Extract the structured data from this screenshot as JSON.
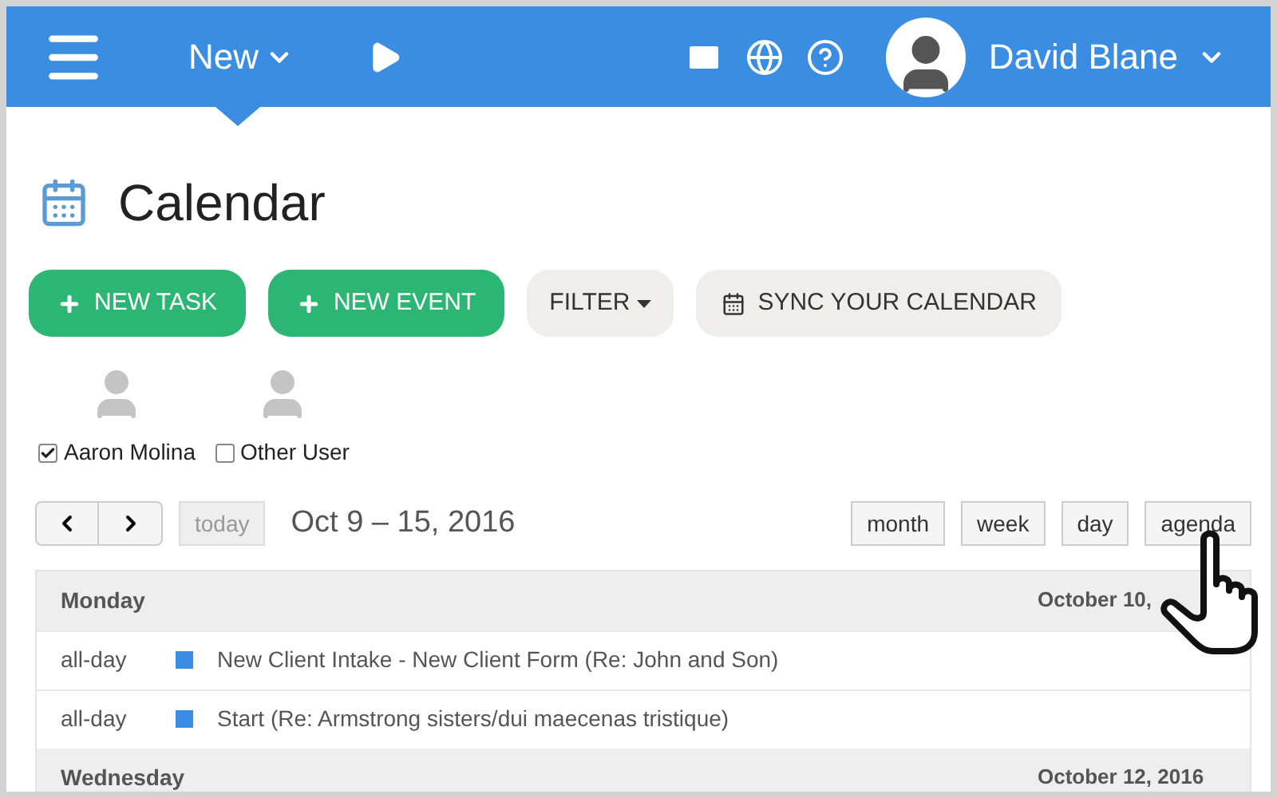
{
  "header": {
    "new_menu": "New",
    "user_name": "David Blane"
  },
  "page_title": "Calendar",
  "actions": [
    {
      "label": "NEW TASK",
      "kind": "primary"
    },
    {
      "label": "NEW EVENT",
      "kind": "primary"
    },
    {
      "label": "FILTER",
      "kind": "dropdown"
    },
    {
      "label": "SYNC YOUR CALENDAR",
      "kind": "sync"
    }
  ],
  "users": [
    {
      "name": "Aaron Molina",
      "checked": true
    },
    {
      "name": "Other User",
      "checked": false
    }
  ],
  "toolbar": {
    "today": "today",
    "range": "Oct 9 – 15, 2016"
  },
  "views": [
    {
      "label": "month",
      "selected": false
    },
    {
      "label": "week",
      "selected": false
    },
    {
      "label": "day",
      "selected": false
    },
    {
      "label": "agenda",
      "selected": false
    }
  ],
  "agenda": [
    {
      "day": "Monday",
      "date": "October 10,",
      "events": [
        {
          "time": "all-day",
          "title": "New Client Intake - New Client Form (Re: John and Son)",
          "color": "#3a8ee6"
        },
        {
          "time": "all-day",
          "title": "Start (Re: Armstrong sisters/dui maecenas tristique)",
          "color": "#3a8ee6"
        }
      ]
    },
    {
      "day": "Wednesday",
      "date": "October 12, 2016"
    }
  ]
}
